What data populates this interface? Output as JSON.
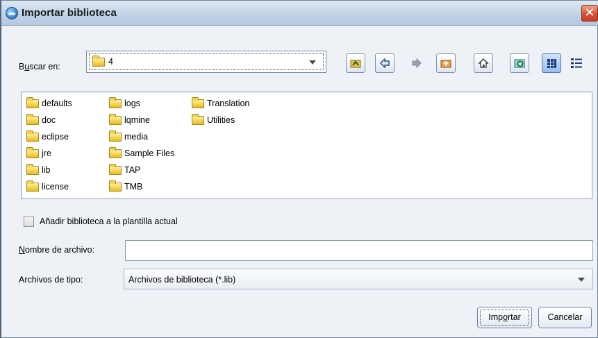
{
  "window": {
    "title": "Importar biblioteca",
    "close_symbol": "✕",
    "icon": "app-globe-icon"
  },
  "look_in": {
    "label_pre": "B",
    "label_underlined": "u",
    "label_post": "scar en:",
    "value": "4"
  },
  "toolbar": {
    "icons": [
      "up-folder-icon",
      "back-arrow-icon",
      "forward-arrow-icon",
      "recent-folder-icon",
      "home-icon",
      "new-folder-icon",
      "list-view-icon",
      "details-view-icon"
    ],
    "active": "list-view-icon"
  },
  "files": {
    "items": [
      "defaults",
      "doc",
      "eclipse",
      "jre",
      "lib",
      "license",
      "logs",
      "lqmine",
      "media",
      "Sample Files",
      "TAP",
      "TMB",
      "Translation",
      "Utilities"
    ]
  },
  "add_to_template": {
    "label": "Añadir biblioteca a la plantilla actual",
    "checked": false
  },
  "file_name": {
    "label_underlined": "N",
    "label_post": "ombre de archivo:",
    "value": ""
  },
  "file_type": {
    "label": "Archivos de tipo:",
    "value": "Archivos de biblioteca (*.lib)"
  },
  "buttons": {
    "import_pre": "Imp",
    "import_underlined": "o",
    "import_post": "rtar",
    "cancel": "Cancelar"
  },
  "colors": {
    "accent": "#3f8fd8",
    "close": "#d9563c",
    "folder": "#f4d24a"
  }
}
